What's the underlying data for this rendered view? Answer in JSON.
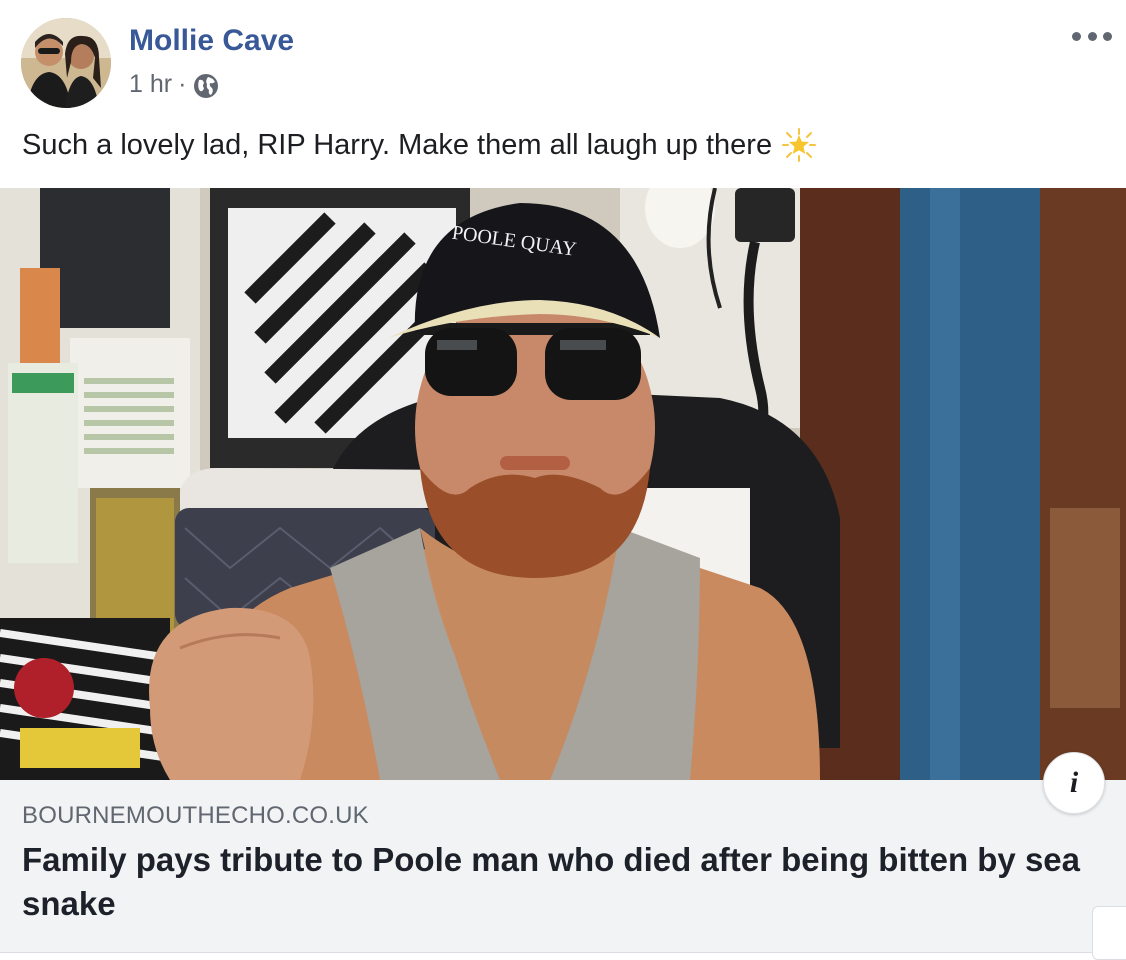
{
  "post": {
    "author": "Mollie Cave",
    "timestamp": "1 hr",
    "separator": "·",
    "privacy_icon": "globe-icon",
    "more_icon": "more-options-icon",
    "caption": "Such a lovely lad, RIP Harry. Make them all laugh up there",
    "caption_emoji": "glowing-star-icon"
  },
  "photo": {
    "cap_text": "POOLE QUAY",
    "info_label": "i"
  },
  "link": {
    "domain": "BOURNEMOUTHECHO.CO.UK",
    "headline": "Family pays tribute to Poole man who died after being bitten by sea snake"
  },
  "colors": {
    "author": "#385898",
    "meta": "#616770",
    "link_bg": "#f2f3f5",
    "headline": "#1d2129"
  }
}
